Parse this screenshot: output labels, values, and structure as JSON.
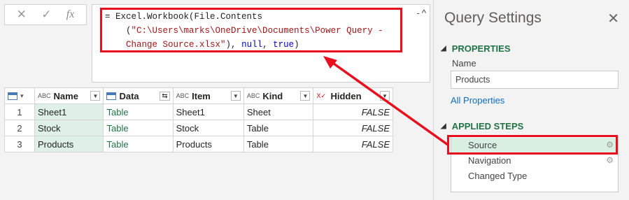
{
  "formula_bar": {
    "cancel_icon": "✕",
    "confirm_icon": "✓",
    "fx_label": "fx",
    "line1": "= Excel.Workbook(File.Contents",
    "line2_str": "\"C:\\Users\\marks\\OneDrive\\Documents\\Power Query -",
    "line3_str": "Change Source.xlsx\"",
    "line3_mid": "), ",
    "line3_null": "null",
    "line3_sep": ", ",
    "line3_true": "true",
    "line3_end": ")",
    "collapse_icon": "^"
  },
  "grid": {
    "columns": [
      {
        "type_icon": "ABC",
        "label": "Name"
      },
      {
        "type_icon": "table",
        "label": "Data"
      },
      {
        "type_icon": "ABC",
        "label": "Item"
      },
      {
        "type_icon": "ABC",
        "label": "Kind"
      },
      {
        "type_icon": "X✓",
        "label": "Hidden"
      }
    ],
    "rows": [
      {
        "n": "1",
        "name": "Sheet1",
        "data": "Table",
        "item": "Sheet1",
        "kind": "Sheet",
        "hidden": "FALSE"
      },
      {
        "n": "2",
        "name": "Stock",
        "data": "Table",
        "item": "Stock",
        "kind": "Table",
        "hidden": "FALSE"
      },
      {
        "n": "3",
        "name": "Products",
        "data": "Table",
        "item": "Products",
        "kind": "Table",
        "hidden": "FALSE"
      }
    ]
  },
  "query_settings": {
    "title": "Query Settings",
    "close_icon": "✕",
    "properties_header": "PROPERTIES",
    "name_label": "Name",
    "name_value": "Products",
    "all_properties_link": "All Properties",
    "applied_steps_header": "APPLIED STEPS",
    "steps": [
      "Source",
      "Navigation",
      "Changed Type"
    ],
    "gear_icon": "⚙"
  },
  "colors": {
    "highlight_red": "#e8101e",
    "selected_green": "#d9efe2",
    "header_green": "#217346"
  }
}
